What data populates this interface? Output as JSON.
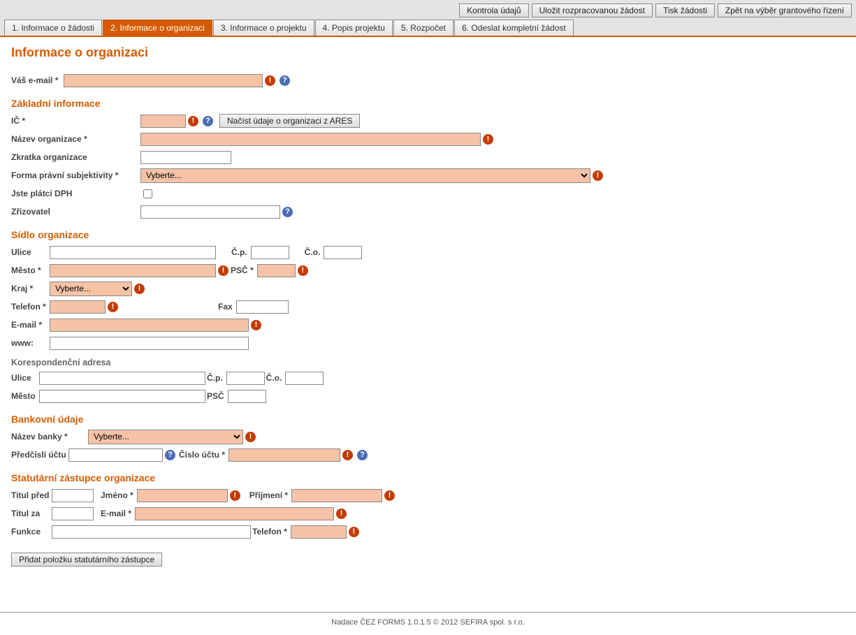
{
  "topButtons": {
    "check": "Kontrola údajů",
    "saveDraft": "Uložit rozpracovanou žádost",
    "print": "Tisk žádosti",
    "back": "Zpět na výběr grantového řízení"
  },
  "tabs": [
    "1. Informace o žádosti",
    "2. Informace o organizaci",
    "3. Informace o projektu",
    "4. Popis projektu",
    "5. Rozpočet",
    "6. Odeslat kompletní žádost"
  ],
  "title": "Informace o organizaci",
  "email": {
    "label": "Váš e-mail *",
    "value": ""
  },
  "basic": {
    "heading": "Základní informace",
    "ic": {
      "label": "IČ *",
      "value": ""
    },
    "aresBtn": "Načíst údaje o organizaci z ARES",
    "orgName": {
      "label": "Název organizace *",
      "value": ""
    },
    "orgAbbrev": {
      "label": "Zkratka organizace",
      "value": ""
    },
    "legalForm": {
      "label": "Forma právní subjektivity *",
      "selected": "Vyberte..."
    },
    "vat": {
      "label": "Jste plátci DPH"
    },
    "founder": {
      "label": "Zřizovatel",
      "value": ""
    }
  },
  "seat": {
    "heading": "Sídlo organizace",
    "street": {
      "label": "Ulice",
      "value": ""
    },
    "cp": {
      "label": "Č.p.",
      "value": ""
    },
    "co": {
      "label": "Č.o.",
      "value": ""
    },
    "city": {
      "label": "Město *",
      "value": ""
    },
    "psc": {
      "label": "PSČ *",
      "value": ""
    },
    "region": {
      "label": "Kraj *",
      "selected": "Vyberte..."
    },
    "phone": {
      "label": "Telefon *",
      "value": ""
    },
    "fax": {
      "label": "Fax",
      "value": ""
    },
    "email": {
      "label": "E-mail *",
      "value": ""
    },
    "www": {
      "label": "www:",
      "value": ""
    }
  },
  "corr": {
    "heading": "Korespondenční adresa",
    "street": {
      "label": "Ulice",
      "value": ""
    },
    "cp": {
      "label": "Č.p.",
      "value": ""
    },
    "co": {
      "label": "Č.o.",
      "value": ""
    },
    "city": {
      "label": "Město",
      "value": ""
    },
    "psc": {
      "label": "PSČ",
      "value": ""
    }
  },
  "bank": {
    "heading": "Bankovní údaje",
    "bankName": {
      "label": "Název banky *",
      "selected": "Vyberte..."
    },
    "prefix": {
      "label": "Předčíslí účtu",
      "value": ""
    },
    "account": {
      "label": "Číslo účtu *",
      "value": ""
    }
  },
  "rep": {
    "heading": "Statutární zástupce organizace",
    "titleBefore": {
      "label": "Titul před",
      "value": ""
    },
    "firstName": {
      "label": "Jméno *",
      "value": ""
    },
    "lastName": {
      "label": "Příjmení *",
      "value": ""
    },
    "titleAfter": {
      "label": "Titul za",
      "value": ""
    },
    "email": {
      "label": "E-mail *",
      "value": ""
    },
    "role": {
      "label": "Funkce",
      "value": ""
    },
    "phone": {
      "label": "Telefon *",
      "value": ""
    },
    "addBtn": "Přidat položku statutárního zástupce"
  },
  "footer": "Nadace ČEZ FORMS 1.0.1.5 © 2012 SEFIRA spol. s r.o."
}
